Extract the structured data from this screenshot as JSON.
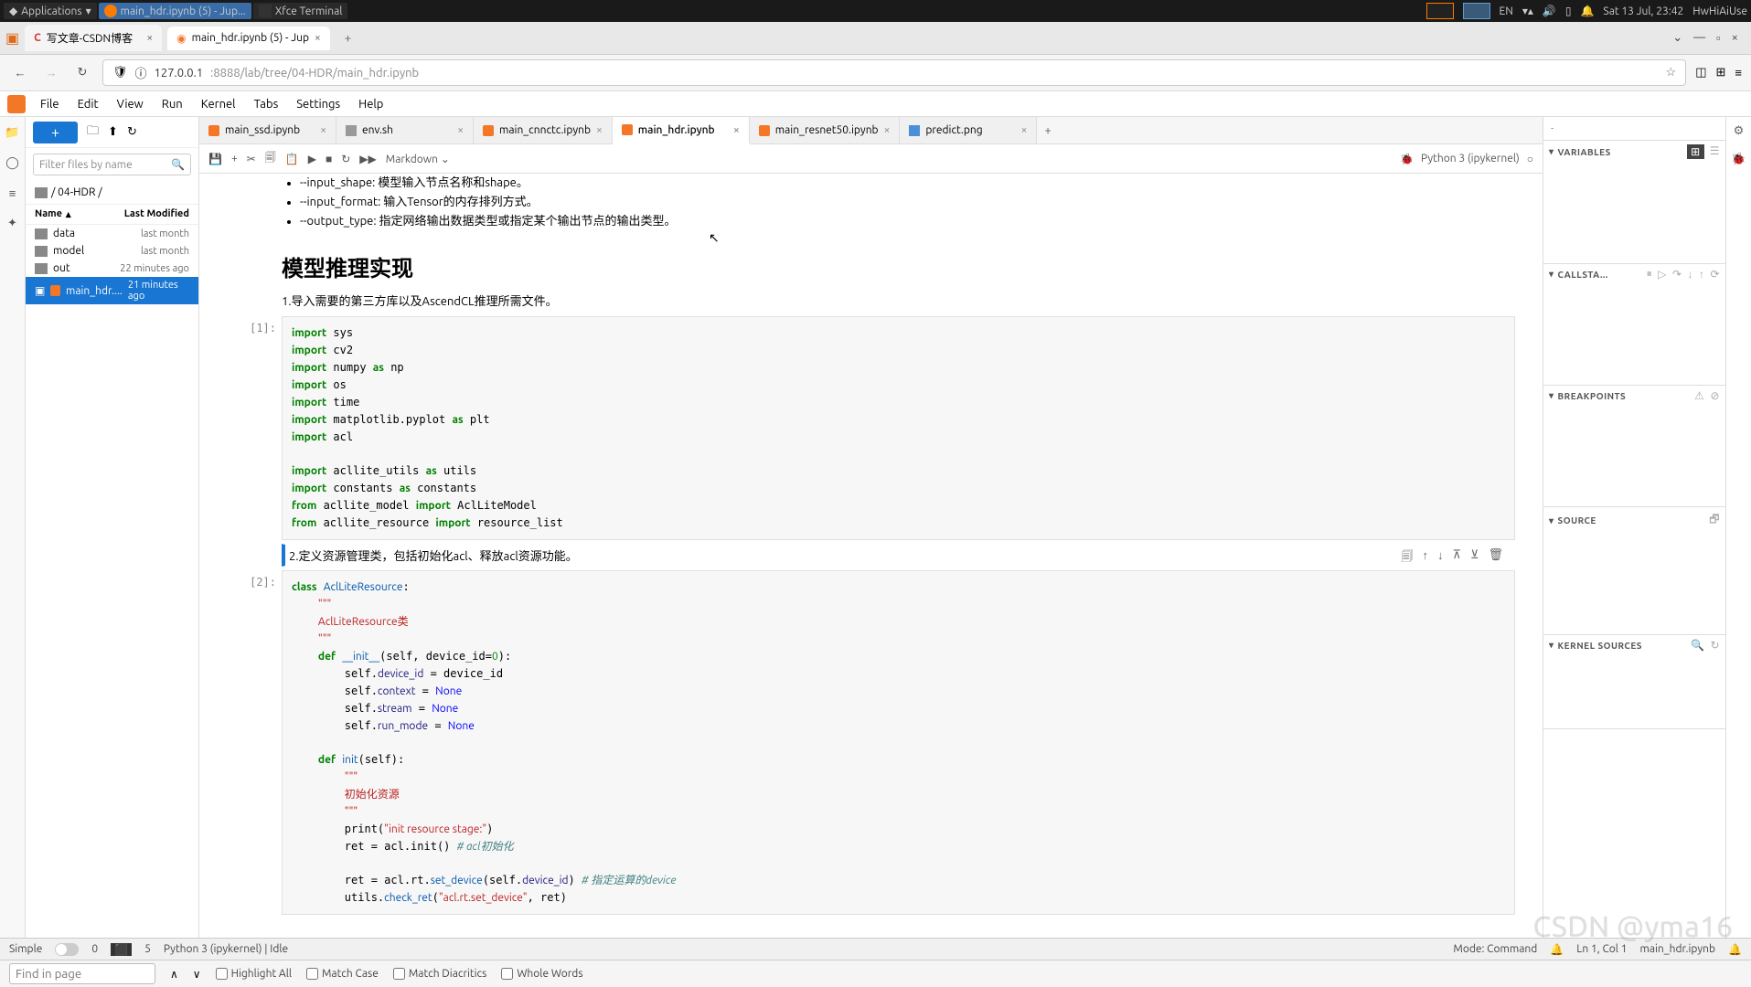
{
  "taskbar": {
    "apps_label": "Applications",
    "task1": "main_hdr.ipynb (5) - Jup...",
    "task2": "Xfce Terminal",
    "lang": "EN",
    "date": "Sat 13 Jul, 23:42",
    "user": "HwHiAiUse"
  },
  "browser_tabs": {
    "tab1": "写文章-CSDN博客",
    "tab2": "main_hdr.ipynb (5) - Jup"
  },
  "url": {
    "host": "127.0.0.1",
    "port_path": ":8888/lab/tree/04-HDR/main_hdr.ipynb"
  },
  "menu": {
    "file": "File",
    "edit": "Edit",
    "view": "View",
    "run": "Run",
    "kernel": "Kernel",
    "tabs": "Tabs",
    "settings": "Settings",
    "help": "Help"
  },
  "left_panel": {
    "search_placeholder": "Filter files by name",
    "breadcrumb": "/ 04-HDR /",
    "col_name": "Name",
    "col_mod": "Last Modified",
    "rows": [
      {
        "name": "data",
        "mod": "last month"
      },
      {
        "name": "model",
        "mod": "last month"
      },
      {
        "name": "out",
        "mod": "22 minutes ago"
      },
      {
        "name": "main_hdr....",
        "mod": "21 minutes ago"
      }
    ]
  },
  "file_tabs": {
    "t1": "main_ssd.ipynb",
    "t2": "env.sh",
    "t3": "main_cnnctc.ipynb",
    "t4": "main_hdr.ipynb",
    "t5": "main_resnet50.ipynb",
    "t6": "predict.png"
  },
  "nb_toolbar": {
    "cell_type": "Markdown",
    "kernel": "Python 3 (ipykernel)"
  },
  "content": {
    "bullet1": "--input_shape:  模型输入节点名称和shape。",
    "bullet2": "--input_format:  输入Tensor的内存排列方式。",
    "bullet3": "--output_type:  指定网络输出数据类型或指定某个输出节点的输出类型。",
    "heading": "模型推理实现",
    "p1": "1.导入需要的第三方库以及AscendCL推理所需文件。",
    "prompt1": "[1]:",
    "p2": "2.定义资源管理类，包括初始化acl、释放acl资源功能。",
    "prompt2": "[2]:"
  },
  "right_panel": {
    "variables": "VARIABLES",
    "callstack": "CALLSTA...",
    "breakpoints": "BREAKPOINTS",
    "source": "SOURCE",
    "kernel_sources": "KERNEL SOURCES"
  },
  "statusbar": {
    "simple": "Simple",
    "zero": "0",
    "five": "5",
    "kernel": "Python 3 (ipykernel) | Idle",
    "mode": "Mode: Command",
    "lncol": "Ln 1, Col 1",
    "filename": "main_hdr.ipynb"
  },
  "findbar": {
    "placeholder": "Find in page",
    "highlight": "Highlight All",
    "matchcase": "Match Case",
    "diacritics": "Match Diacritics",
    "whole": "Whole Words"
  },
  "watermark": "CSDN @yma16"
}
